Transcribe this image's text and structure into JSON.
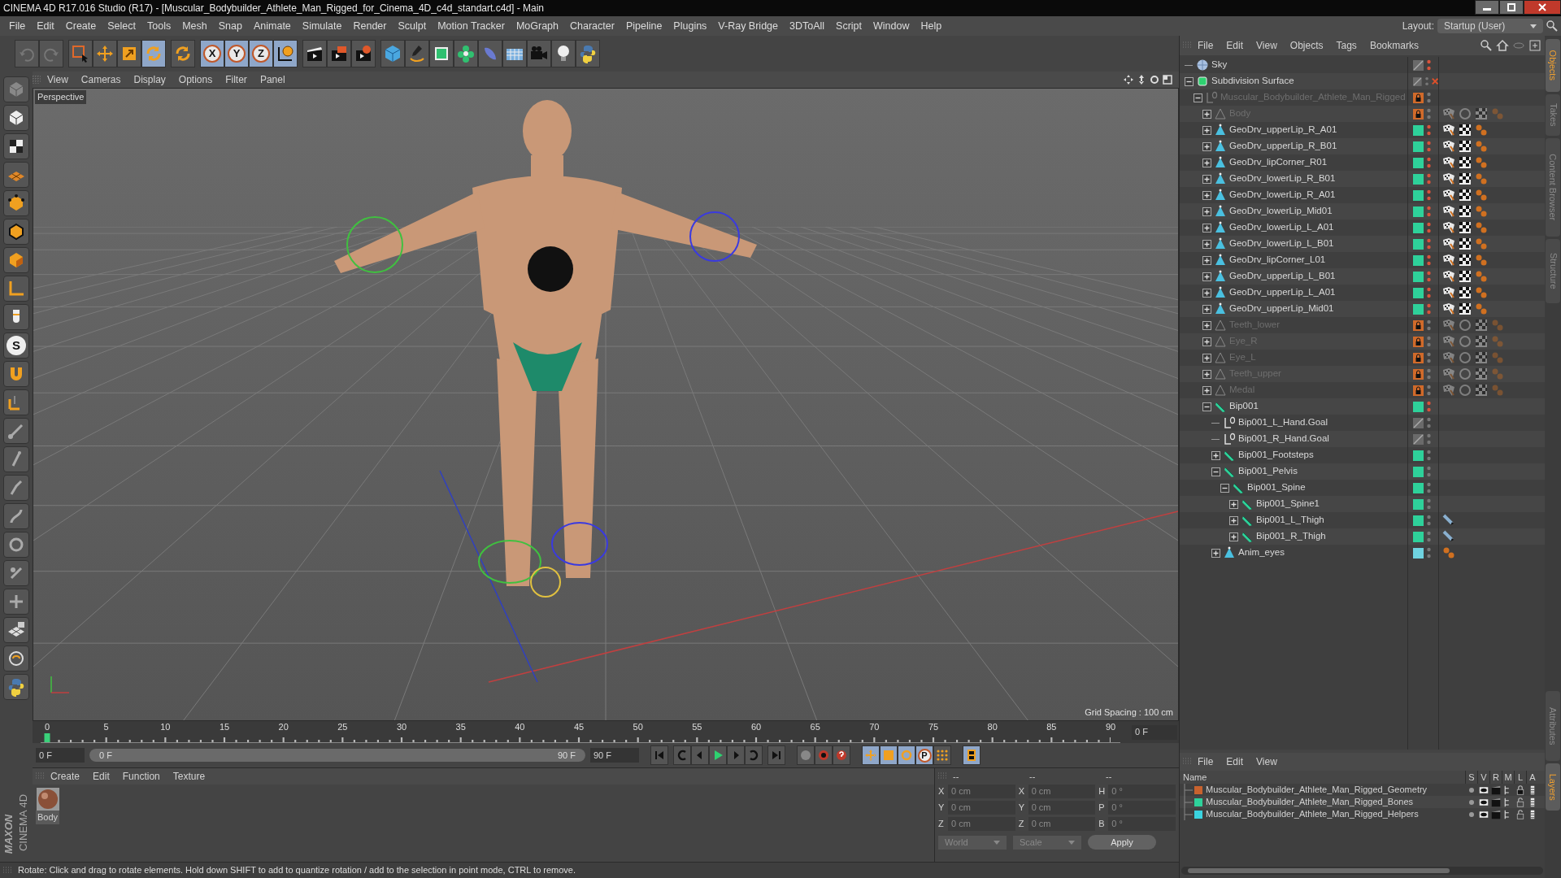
{
  "window": {
    "title": "CINEMA 4D R17.016 Studio (R17) - [Muscular_Bodybuilder_Athlete_Man_Rigged_for_Cinema_4D_c4d_standart.c4d] - Main"
  },
  "menu_bar": [
    "File",
    "Edit",
    "Create",
    "Select",
    "Tools",
    "Mesh",
    "Snap",
    "Animate",
    "Simulate",
    "Render",
    "Sculpt",
    "Motion Tracker",
    "MoGraph",
    "Character",
    "Pipeline",
    "Plugins",
    "V-Ray Bridge",
    "3DToAll",
    "Script",
    "Window",
    "Help"
  ],
  "layout": {
    "label": "Layout:",
    "value": "Startup (User)"
  },
  "toolbar": {
    "axis_buttons": [
      "X",
      "Y",
      "Z"
    ]
  },
  "left_toolbar": {
    "sculpt_letter": "S"
  },
  "viewport": {
    "menu": [
      "View",
      "Cameras",
      "Display",
      "Options",
      "Filter",
      "Panel"
    ],
    "camera": "Perspective",
    "grid_spacing": "Grid Spacing : 100 cm"
  },
  "timeline": {
    "ticks": [
      "0",
      "5",
      "10",
      "15",
      "20",
      "25",
      "30",
      "35",
      "40",
      "45",
      "50",
      "55",
      "60",
      "65",
      "70",
      "75",
      "80",
      "85",
      "90"
    ],
    "playhead": {
      "level": 0
    },
    "current_frame": "0 F",
    "start_field": "0 F",
    "range_slider": {
      "level": 1
    },
    "range_start": "0 F",
    "range_end": "90 F",
    "end_field": "90 F",
    "key_button": "P"
  },
  "material_manager": {
    "menu": [
      "Create",
      "Edit",
      "Function",
      "Texture"
    ],
    "materials": [
      {
        "name": "Body"
      }
    ]
  },
  "logo": {
    "lines": [
      "MAXON",
      "CINEMA 4D"
    ]
  },
  "coordinates": {
    "headers": [
      "--",
      "--",
      "--"
    ],
    "columns": [
      [
        {
          "axis": "X",
          "value": "0 cm"
        },
        {
          "axis": "Y",
          "value": "0 cm"
        },
        {
          "axis": "Z",
          "value": "0 cm"
        }
      ],
      [
        {
          "axis": "X",
          "value": "0 cm"
        },
        {
          "axis": "Y",
          "value": "0 cm"
        },
        {
          "axis": "Z",
          "value": "0 cm"
        }
      ],
      [
        {
          "axis": "H",
          "value": "0 °"
        },
        {
          "axis": "P",
          "value": "0 °"
        },
        {
          "axis": "B",
          "value": "0 °"
        }
      ]
    ],
    "dropdowns": [
      "World",
      "Scale"
    ],
    "apply": "Apply"
  },
  "status_bar": "Rotate: Click and drag to rotate elements. Hold down SHIFT to add to quantize rotation / add to the selection in point mode, CTRL to remove.",
  "object_manager": {
    "menu": [
      "File",
      "Edit",
      "View",
      "Objects",
      "Tags",
      "Bookmarks"
    ],
    "tree": [
      {
        "name": "Sky",
        "kind": "sky",
        "dimmed": false,
        "enabled": true,
        "layer_locked": false,
        "visible": true
      },
      {
        "name": "Subdivision Surface",
        "kind": "subdivision",
        "dimmed": false,
        "enabled": false,
        "layer_locked": false,
        "visible": false,
        "expanded": true,
        "children": [
          {
            "name": "Muscular_Bodybuilder_Athlete_Man_Rigged",
            "kind": "null",
            "dimmed": true,
            "enabled": true,
            "layer_locked": true,
            "visible": false,
            "expanded": true,
            "children": [
              {
                "name": "Body",
                "kind": "polygon",
                "dimmed": true,
                "enabled": true,
                "layer_locked": true,
                "visible": false,
                "expanded": false,
                "tags": [
                  {
                    "kind": "flag"
                  },
                  {
                    "kind": "ring"
                  },
                  {
                    "kind": "checker"
                  },
                  {
                    "kind": "dots"
                  }
                ]
              },
              {
                "name": "GeoDrv_upperLip_R_A01",
                "kind": "polygon",
                "dimmed": false,
                "enabled": true,
                "color": "#2ed19a",
                "visible": true,
                "expanded": false,
                "tags": [
                  {
                    "kind": "flag"
                  },
                  {
                    "kind": "checker"
                  },
                  {
                    "kind": "dots"
                  }
                ]
              },
              {
                "name": "GeoDrv_upperLip_R_B01",
                "kind": "polygon",
                "dimmed": false,
                "enabled": true,
                "color": "#2ed19a",
                "visible": true,
                "expanded": false,
                "tags": [
                  {
                    "kind": "flag"
                  },
                  {
                    "kind": "checker"
                  },
                  {
                    "kind": "dots"
                  }
                ]
              },
              {
                "name": "GeoDrv_lipCorner_R01",
                "kind": "polygon",
                "dimmed": false,
                "enabled": true,
                "color": "#2ed19a",
                "visible": true,
                "expanded": false,
                "tags": [
                  {
                    "kind": "flag"
                  },
                  {
                    "kind": "checker"
                  },
                  {
                    "kind": "dots"
                  }
                ]
              },
              {
                "name": "GeoDrv_lowerLip_R_B01",
                "kind": "polygon",
                "dimmed": false,
                "enabled": true,
                "color": "#2ed19a",
                "visible": true,
                "expanded": false,
                "tags": [
                  {
                    "kind": "flag"
                  },
                  {
                    "kind": "checker"
                  },
                  {
                    "kind": "dots"
                  }
                ]
              },
              {
                "name": "GeoDrv_lowerLip_R_A01",
                "kind": "polygon",
                "dimmed": false,
                "enabled": true,
                "color": "#2ed19a",
                "visible": true,
                "expanded": false,
                "tags": [
                  {
                    "kind": "flag"
                  },
                  {
                    "kind": "checker"
                  },
                  {
                    "kind": "dots"
                  }
                ]
              },
              {
                "name": "GeoDrv_lowerLip_Mid01",
                "kind": "polygon",
                "dimmed": false,
                "enabled": true,
                "color": "#2ed19a",
                "visible": true,
                "expanded": false,
                "tags": [
                  {
                    "kind": "flag"
                  },
                  {
                    "kind": "checker"
                  },
                  {
                    "kind": "dots"
                  }
                ]
              },
              {
                "name": "GeoDrv_lowerLip_L_A01",
                "kind": "polygon",
                "dimmed": false,
                "enabled": true,
                "color": "#2ed19a",
                "visible": true,
                "expanded": false,
                "tags": [
                  {
                    "kind": "flag"
                  },
                  {
                    "kind": "checker"
                  },
                  {
                    "kind": "dots"
                  }
                ]
              },
              {
                "name": "GeoDrv_lowerLip_L_B01",
                "kind": "polygon",
                "dimmed": false,
                "enabled": true,
                "color": "#2ed19a",
                "visible": true,
                "expanded": false,
                "tags": [
                  {
                    "kind": "flag"
                  },
                  {
                    "kind": "checker"
                  },
                  {
                    "kind": "dots"
                  }
                ]
              },
              {
                "name": "GeoDrv_lipCorner_L01",
                "kind": "polygon",
                "dimmed": false,
                "enabled": true,
                "color": "#2ed19a",
                "visible": true,
                "expanded": false,
                "tags": [
                  {
                    "kind": "flag"
                  },
                  {
                    "kind": "checker"
                  },
                  {
                    "kind": "dots"
                  }
                ]
              },
              {
                "name": "GeoDrv_upperLip_L_B01",
                "kind": "polygon",
                "dimmed": false,
                "enabled": true,
                "color": "#2ed19a",
                "visible": true,
                "expanded": false,
                "tags": [
                  {
                    "kind": "flag"
                  },
                  {
                    "kind": "checker"
                  },
                  {
                    "kind": "dots"
                  }
                ]
              },
              {
                "name": "GeoDrv_upperLip_L_A01",
                "kind": "polygon",
                "dimmed": false,
                "enabled": true,
                "color": "#2ed19a",
                "visible": true,
                "expanded": false,
                "tags": [
                  {
                    "kind": "flag"
                  },
                  {
                    "kind": "checker"
                  },
                  {
                    "kind": "dots"
                  }
                ]
              },
              {
                "name": "GeoDrv_upperLip_Mid01",
                "kind": "polygon",
                "dimmed": false,
                "enabled": true,
                "color": "#2ed19a",
                "visible": true,
                "expanded": false,
                "tags": [
                  {
                    "kind": "flag"
                  },
                  {
                    "kind": "checker"
                  },
                  {
                    "kind": "dots"
                  }
                ]
              },
              {
                "name": "Teeth_lower",
                "kind": "polygon",
                "dimmed": true,
                "enabled": true,
                "layer_locked": true,
                "visible": false,
                "expanded": false,
                "tags": [
                  {
                    "kind": "flag"
                  },
                  {
                    "kind": "ring"
                  },
                  {
                    "kind": "checker"
                  },
                  {
                    "kind": "dots"
                  }
                ]
              },
              {
                "name": "Eye_R",
                "kind": "polygon",
                "dimmed": true,
                "enabled": true,
                "layer_locked": true,
                "visible": false,
                "expanded": false,
                "tags": [
                  {
                    "kind": "flag"
                  },
                  {
                    "kind": "ring"
                  },
                  {
                    "kind": "checker"
                  },
                  {
                    "kind": "dots"
                  }
                ]
              },
              {
                "name": "Eye_L",
                "kind": "polygon",
                "dimmed": true,
                "enabled": true,
                "layer_locked": true,
                "visible": false,
                "expanded": false,
                "tags": [
                  {
                    "kind": "flag"
                  },
                  {
                    "kind": "ring"
                  },
                  {
                    "kind": "checker"
                  },
                  {
                    "kind": "dots"
                  }
                ]
              },
              {
                "name": "Teeth_upper",
                "kind": "polygon",
                "dimmed": true,
                "enabled": true,
                "layer_locked": true,
                "visible": false,
                "expanded": false,
                "tags": [
                  {
                    "kind": "flag"
                  },
                  {
                    "kind": "ring"
                  },
                  {
                    "kind": "checker"
                  },
                  {
                    "kind": "dots"
                  }
                ]
              },
              {
                "name": "Medal",
                "kind": "polygon",
                "dimmed": true,
                "enabled": true,
                "layer_locked": true,
                "visible": false,
                "expanded": false,
                "tags": [
                  {
                    "kind": "flag"
                  },
                  {
                    "kind": "ring"
                  },
                  {
                    "kind": "checker"
                  },
                  {
                    "kind": "dots"
                  }
                ]
              },
              {
                "name": "Bip001",
                "kind": "bone",
                "dimmed": false,
                "enabled": true,
                "color": "#2ed19a",
                "visible": true,
                "expanded": true,
                "children": [
                  {
                    "name": "Bip001_L_Hand.Goal",
                    "kind": "null",
                    "dimmed": false,
                    "enabled": true,
                    "layer_locked": false,
                    "visible": false
                  },
                  {
                    "name": "Bip001_R_Hand.Goal",
                    "kind": "null",
                    "dimmed": false,
                    "enabled": true,
                    "layer_locked": false,
                    "visible": false
                  },
                  {
                    "name": "Bip001_Footsteps",
                    "kind": "bone",
                    "dimmed": false,
                    "enabled": true,
                    "color": "#2ed19a",
                    "visible": false,
                    "expanded": false
                  },
                  {
                    "name": "Bip001_Pelvis",
                    "kind": "bone",
                    "dimmed": false,
                    "enabled": true,
                    "color": "#2ed19a",
                    "visible": false,
                    "expanded": true,
                    "children": [
                      {
                        "name": "Bip001_Spine",
                        "kind": "bone",
                        "dimmed": false,
                        "enabled": true,
                        "color": "#2ed19a",
                        "visible": false,
                        "expanded": true,
                        "children": [
                          {
                            "name": "Bip001_Spine1",
                            "kind": "bone",
                            "dimmed": false,
                            "enabled": true,
                            "color": "#2ed19a",
                            "visible": false,
                            "expanded": false
                          },
                          {
                            "name": "Bip001_L_Thigh",
                            "kind": "bone",
                            "dimmed": false,
                            "enabled": true,
                            "color": "#2ed19a",
                            "visible": false,
                            "expanded": false,
                            "tags": [
                              {
                                "kind": "bone"
                              }
                            ]
                          },
                          {
                            "name": "Bip001_R_Thigh",
                            "kind": "bone",
                            "dimmed": false,
                            "enabled": true,
                            "color": "#2ed19a",
                            "visible": false,
                            "expanded": false,
                            "tags": [
                              {
                                "kind": "bone"
                              }
                            ]
                          }
                        ]
                      }
                    ]
                  },
                  {
                    "name": "Anim_eyes",
                    "kind": "polygon",
                    "dimmed": false,
                    "enabled": true,
                    "color": "#6fd3e0",
                    "visible": false,
                    "expanded": false,
                    "tags": [
                      {
                        "kind": "dots"
                      }
                    ]
                  }
                ]
              }
            ]
          }
        ]
      }
    ]
  },
  "layer_manager": {
    "menu": [
      "File",
      "Edit",
      "View"
    ],
    "columns": [
      "Name",
      "S",
      "V",
      "R",
      "M",
      "L",
      "A"
    ],
    "rows": [
      {
        "name": "Muscular_Bodybuilder_Athlete_Man_Rigged_Geometry",
        "color": "#c8622e",
        "locked": true
      },
      {
        "name": "Muscular_Bodybuilder_Athlete_Man_Rigged_Bones",
        "color": "#2ed19a",
        "locked": false
      },
      {
        "name": "Muscular_Bodybuilder_Athlete_Man_Rigged_Helpers",
        "color": "#3ad3e0",
        "locked": false
      }
    ]
  },
  "side_tabs": [
    {
      "label": "Objects",
      "selected": true
    },
    {
      "label": "Takes",
      "selected": false
    },
    {
      "label": "Content Browser",
      "selected": false
    },
    {
      "label": "Structure",
      "selected": false
    }
  ],
  "bottom_side_tabs": [
    {
      "label": "Attributes",
      "selected": false
    },
    {
      "label": "Layers",
      "selected": true
    }
  ]
}
